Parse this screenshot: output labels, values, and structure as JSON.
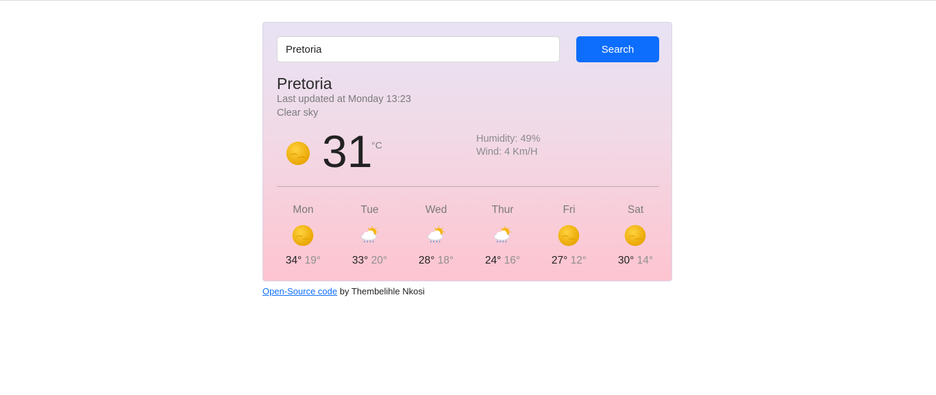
{
  "search": {
    "value": "Pretoria",
    "button_label": "Search"
  },
  "current": {
    "city": "Pretoria",
    "updated": "Last updated at Monday 13:23",
    "description": "Clear sky",
    "temperature": "31",
    "unit": "°C",
    "humidity": "Humidity: 49%",
    "wind": "Wind: 4 Km/H",
    "icon": "sun-icon"
  },
  "forecast": [
    {
      "day": "Mon",
      "max": "34°",
      "min": "19°",
      "icon": "sun-icon"
    },
    {
      "day": "Tue",
      "max": "33°",
      "min": "20°",
      "icon": "rain-cloud-sun-icon"
    },
    {
      "day": "Wed",
      "max": "28°",
      "min": "18°",
      "icon": "rain-cloud-sun-icon"
    },
    {
      "day": "Thur",
      "max": "24°",
      "min": "16°",
      "icon": "rain-cloud-sun-icon"
    },
    {
      "day": "Fri",
      "max": "27°",
      "min": "12°",
      "icon": "sun-icon"
    },
    {
      "day": "Sat",
      "max": "30°",
      "min": "14°",
      "icon": "sun-icon"
    }
  ],
  "footer": {
    "link_text": "Open-Source code",
    "author_text": " by Thembelihle Nkosi"
  },
  "colors": {
    "accent": "#0d6efd",
    "sun": "#f5b50c"
  }
}
